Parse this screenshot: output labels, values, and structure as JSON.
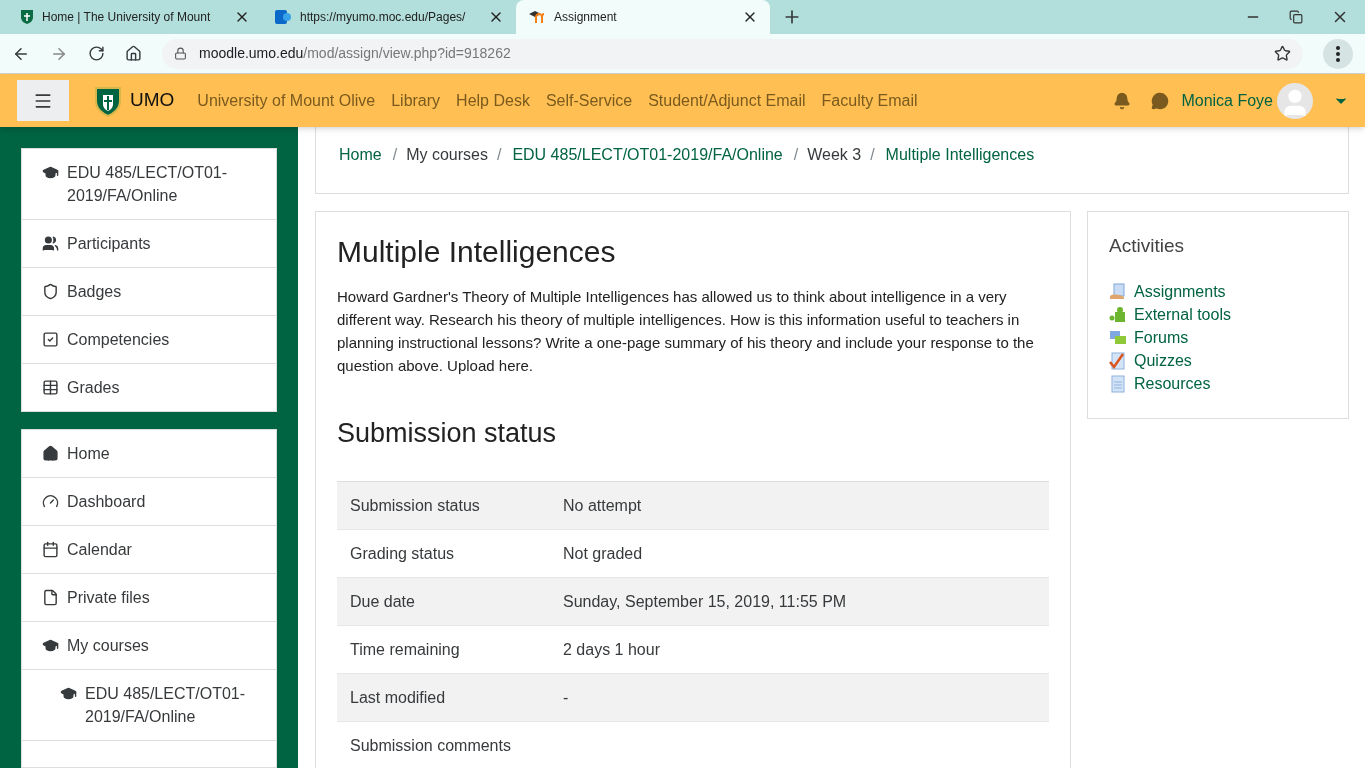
{
  "browser": {
    "tabs": [
      {
        "title": "Home | The University of Mount",
        "selected": false
      },
      {
        "title": "https://myumo.moc.edu/Pages/",
        "selected": false
      },
      {
        "title": "Assignment",
        "selected": true
      }
    ],
    "url_host": "moodle.umo.edu",
    "url_path": "/mod/assign/view.php?id=918262"
  },
  "header": {
    "site": "UMO",
    "links": [
      "University of Mount Olive",
      "Library",
      "Help Desk",
      "Self-Service",
      "Student/Adjunct Email",
      "Faculty Email"
    ],
    "user": "Monica Foye"
  },
  "sidebar": {
    "course_block": [
      {
        "label": "EDU 485/LECT/OT01-2019/FA/Online"
      },
      {
        "label": "Participants"
      },
      {
        "label": "Badges"
      },
      {
        "label": "Competencies"
      },
      {
        "label": "Grades"
      }
    ],
    "nav_block": [
      {
        "label": "Home"
      },
      {
        "label": "Dashboard"
      },
      {
        "label": "Calendar"
      },
      {
        "label": "Private files"
      },
      {
        "label": "My courses",
        "children": [
          {
            "label": "EDU 485/LECT/OT01-2019/FA/Online"
          }
        ]
      }
    ]
  },
  "breadcrumb": [
    {
      "label": "Home",
      "link": true
    },
    {
      "separator_before": "/",
      "label": "My courses",
      "link": false
    },
    {
      "separator_before": "/",
      "label": "EDU 485/LECT/OT01-2019/FA/Online",
      "link": true
    },
    {
      "separator_before": "/",
      "label": "Week 3",
      "link": false
    },
    {
      "separator_before": "/",
      "label": "Multiple Intelligences",
      "link": true
    }
  ],
  "assignment": {
    "title": "Multiple Intelligences",
    "description": "Howard Gardner's Theory of Multiple Intelligences has allowed us to think about intelligence in a very different way. Research his theory of multiple intelligences. How is this information useful to teachers in planning instructional lessons? Write a one-page summary of his theory and include your response to the question above. Upload here.",
    "status_heading": "Submission status",
    "rows": [
      {
        "label": "Submission status",
        "value": "No attempt",
        "striped": true
      },
      {
        "label": "Grading status",
        "value": "Not graded",
        "striped": false
      },
      {
        "label": "Due date",
        "value": "Sunday, September 15, 2019, 11:55 PM",
        "striped": true
      },
      {
        "label": "Time remaining",
        "value": "2 days 1 hour",
        "striped": false
      },
      {
        "label": "Last modified",
        "value": "-",
        "striped": true
      },
      {
        "label": "Submission comments",
        "striped": false
      }
    ]
  },
  "activities": {
    "title": "Activities",
    "items": [
      "Assignments",
      "External tools",
      "Forums",
      "Quizzes",
      "Resources"
    ]
  }
}
